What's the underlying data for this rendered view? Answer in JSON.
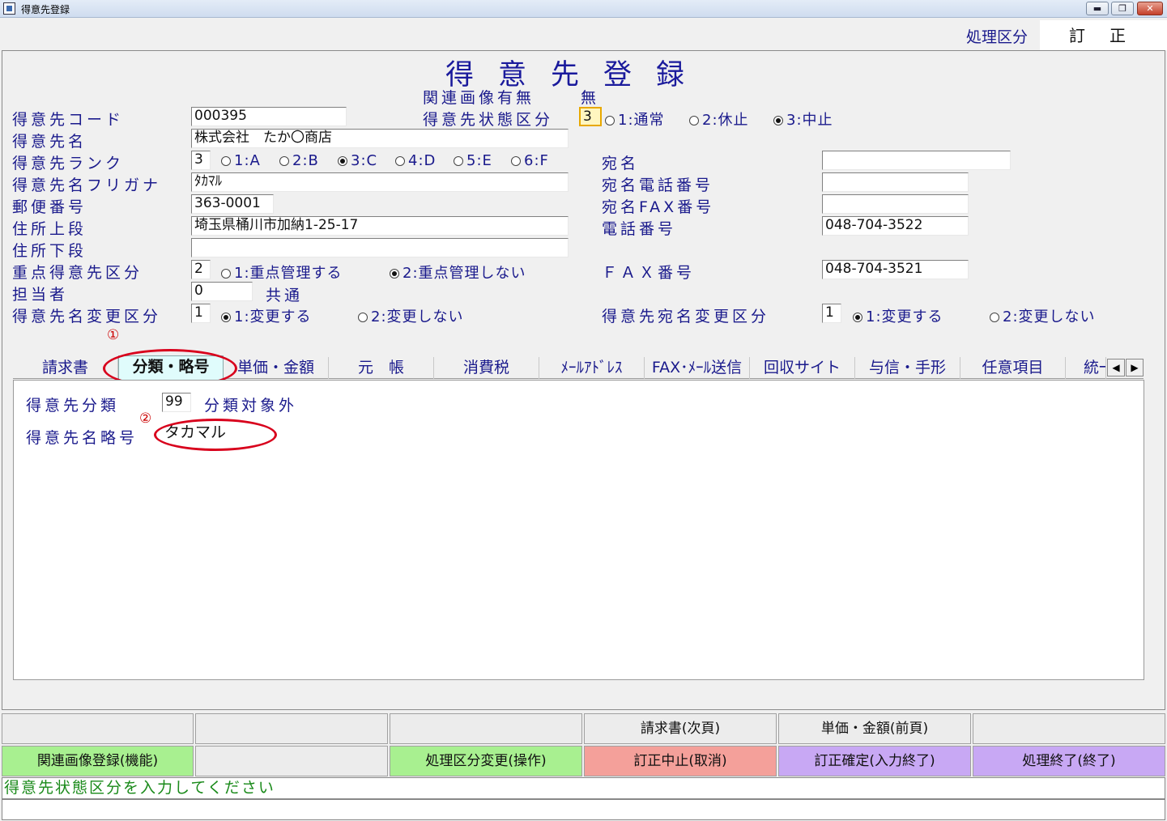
{
  "window": {
    "title": "得意先登録",
    "minimize": "▬",
    "restore": "❐",
    "close": "✕"
  },
  "header": {
    "mode_label": "処理区分",
    "mode_value": "訂正"
  },
  "form": {
    "heading": "得意先登録",
    "image_label": "関連画像有無",
    "image_value": "無",
    "code_label": "得意先コード",
    "code_value": "000395",
    "status_label": "得意先状態区分",
    "status_value": "3",
    "status_options": [
      "1:通常",
      "2:休止",
      "3:中止"
    ],
    "status_selected": 2,
    "name_label": "得意先名",
    "name_value": "株式会社　たか〇商店",
    "rank_label": "得意先ランク",
    "rank_value": "3",
    "rank_options": [
      "1:A",
      "2:B",
      "3:C",
      "4:D",
      "5:E",
      "6:F"
    ],
    "rank_selected": 2,
    "kana_label": "得意先名フリガナ",
    "kana_value": "ﾀｶﾏﾙ",
    "zip_label": "郵便番号",
    "zip_value": "363-0001",
    "addr1_label": "住所上段",
    "addr1_value": "埼玉県桶川市加納1-25-17",
    "addr2_label": "住所下段",
    "addr2_value": "",
    "priority_label": "重点得意先区分",
    "priority_value": "2",
    "priority_options": [
      "1:重点管理する",
      "2:重点管理しない"
    ],
    "priority_selected": 1,
    "staff_label": "担当者",
    "staff_value": "0",
    "staff_name": "共通",
    "namechg_label": "得意先名変更区分",
    "namechg_value": "1",
    "namechg_options": [
      "1:変更する",
      "2:変更しない"
    ],
    "namechg_selected": 0,
    "atena_label": "宛名",
    "atena_value": "",
    "atena_tel_label": "宛名電話番号",
    "atena_tel_value": "",
    "atena_fax_label": "宛名FAX番号",
    "atena_fax_value": "",
    "tel_label": "電話番号",
    "tel_value": "048-704-3522",
    "fax_label": "ＦＡＸ番号",
    "fax_value": "048-704-3521",
    "atenachg_label": "得意先宛名変更区分",
    "atenachg_value": "1",
    "atenachg_options": [
      "1:変更する",
      "2:変更しない"
    ],
    "atenachg_selected": 0
  },
  "markers": {
    "one": "①",
    "two": "②"
  },
  "tabs": [
    "請求書",
    "分類・略号",
    "単価・金額",
    "元　帳",
    "消費税",
    "ﾒｰﾙｱﾄﾞﾚｽ",
    "FAX･ﾒｰﾙ送信",
    "回収サイト",
    "与信・手形",
    "任意項目",
    "統一"
  ],
  "active_tab": 1,
  "tab_arrows": {
    "left": "◀",
    "right": "▶"
  },
  "tab_content": {
    "class_label": "得意先分類",
    "class_value": "99",
    "class_name": "分類対象外",
    "abbr_label": "得意先名略号",
    "abbr_value": "タカマル"
  },
  "function_keys": {
    "row1": [
      "",
      "",
      "",
      "請求書(次頁)",
      "単価・金額(前頁)",
      ""
    ],
    "row2": [
      "関連画像登録(機能)",
      "",
      "処理区分変更(操作)",
      "訂正中止(取消)",
      "訂正確定(入力終了)",
      "処理終了(終了)"
    ]
  },
  "status_message": "得意先状態区分を入力してください",
  "colors": {
    "label_blue": "#1a1a8c",
    "key_green": "#a8f090",
    "key_red": "#f4a09a",
    "key_purple": "#c8a8f4",
    "highlight_red": "#d8001c"
  }
}
